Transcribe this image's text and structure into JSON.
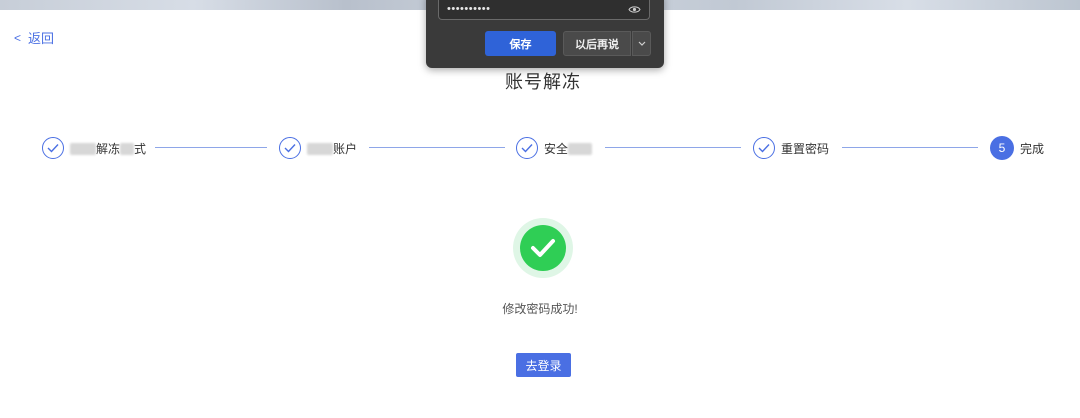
{
  "nav": {
    "back_label": "返回"
  },
  "page": {
    "title": "账号解冻"
  },
  "steps": [
    {
      "label": "解冻",
      "label_suffix": "式",
      "state": "done"
    },
    {
      "label": "账户",
      "state": "done"
    },
    {
      "label": "安全",
      "state": "done"
    },
    {
      "label": "重置密码",
      "state": "done"
    },
    {
      "number": "5",
      "label": "完成",
      "state": "active"
    }
  ],
  "result": {
    "message": "修改密码成功!",
    "login_button": "去登录"
  },
  "password_popup": {
    "masked_value": "••••••••••",
    "save_label": "保存",
    "later_label": "以后再说"
  },
  "colors": {
    "accent": "#4a6fe3",
    "success": "#2fce55",
    "popup_bg": "#3a3a3a",
    "popup_save": "#2f63d8"
  }
}
